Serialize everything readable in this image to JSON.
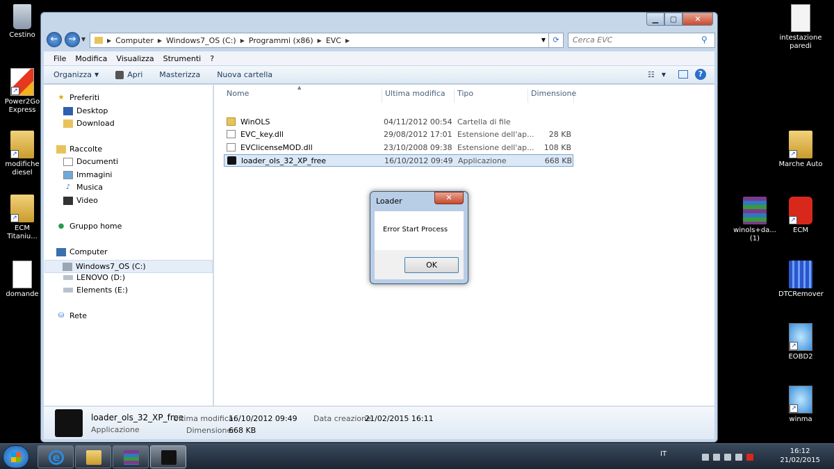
{
  "desktop": {
    "left_icons": [
      {
        "label": "Cestino",
        "icon": "recycle-bin-icon"
      },
      {
        "label": "Power2Go Express",
        "icon": "power2go-icon"
      },
      {
        "label": "modifiche diesel",
        "icon": "folder-icon"
      },
      {
        "label": "ECM Titaniu...",
        "icon": "folder-icon"
      },
      {
        "label": "domande",
        "icon": "document-icon"
      }
    ],
    "right_icons": [
      {
        "label": "intestazione paredi",
        "icon": "document-icon"
      },
      {
        "label": "Marche Auto",
        "icon": "folder-shortcut-icon"
      },
      {
        "label": "winols+da... (1)",
        "icon": "winrar-icon"
      },
      {
        "label": "ECM",
        "icon": "ecm-icon"
      },
      {
        "label": "DTCRemover",
        "icon": "dtcremover-icon"
      },
      {
        "label": "EOBD2",
        "icon": "eobd2-icon"
      },
      {
        "label": "winma",
        "icon": "winma-icon"
      }
    ]
  },
  "explorer": {
    "address": [
      "Computer",
      "Windows7_OS (C:)",
      "Programmi (x86)",
      "EVC"
    ],
    "search_placeholder": "Cerca EVC",
    "menu": [
      "File",
      "Modifica",
      "Visualizza",
      "Strumenti",
      "?"
    ],
    "toolbar": {
      "organize": "Organizza",
      "open": "Apri",
      "burn": "Masterizza",
      "new_folder": "Nuova cartella"
    },
    "nav": {
      "favorites": "Preferiti",
      "desktop": "Desktop",
      "download": "Download",
      "libraries": "Raccolte",
      "documents": "Documenti",
      "images": "Immagini",
      "music": "Musica",
      "video": "Video",
      "homegroup": "Gruppo home",
      "computer": "Computer",
      "drive_c": "Windows7_OS (C:)",
      "drive_d": "LENOVO (D:)",
      "drive_e": "Elements (E:)",
      "network": "Rete"
    },
    "columns": {
      "name": "Nome",
      "modified": "Ultima modifica",
      "type": "Tipo",
      "size": "Dimensione"
    },
    "files": [
      {
        "name": "WinOLS",
        "modified": "04/11/2012 00:54",
        "type": "Cartella di file",
        "size": ""
      },
      {
        "name": "EVC_key.dll",
        "modified": "29/08/2012 17:01",
        "type": "Estensione dell'ap...",
        "size": "28 KB"
      },
      {
        "name": "EVClicenseMOD.dll",
        "modified": "23/10/2008 09:38",
        "type": "Estensione dell'ap...",
        "size": "108 KB"
      },
      {
        "name": "loader_ols_32_XP_free",
        "modified": "16/10/2012 09:49",
        "type": "Applicazione",
        "size": "668 KB"
      }
    ],
    "details": {
      "name": "loader_ols_32_XP_free",
      "kind": "Applicazione",
      "modified_label": "Ultima modifica:",
      "modified_value": "16/10/2012 09:49",
      "created_label": "Data creazione:",
      "created_value": "21/02/2015 16:11",
      "size_label": "Dimensione:",
      "size_value": "668 KB"
    }
  },
  "dialog": {
    "title": "Loader",
    "message": "Error Start Process",
    "ok": "OK",
    "close": "✕"
  },
  "taskbar": {
    "lang": "IT",
    "time": "16:12",
    "date": "21/02/2015"
  }
}
